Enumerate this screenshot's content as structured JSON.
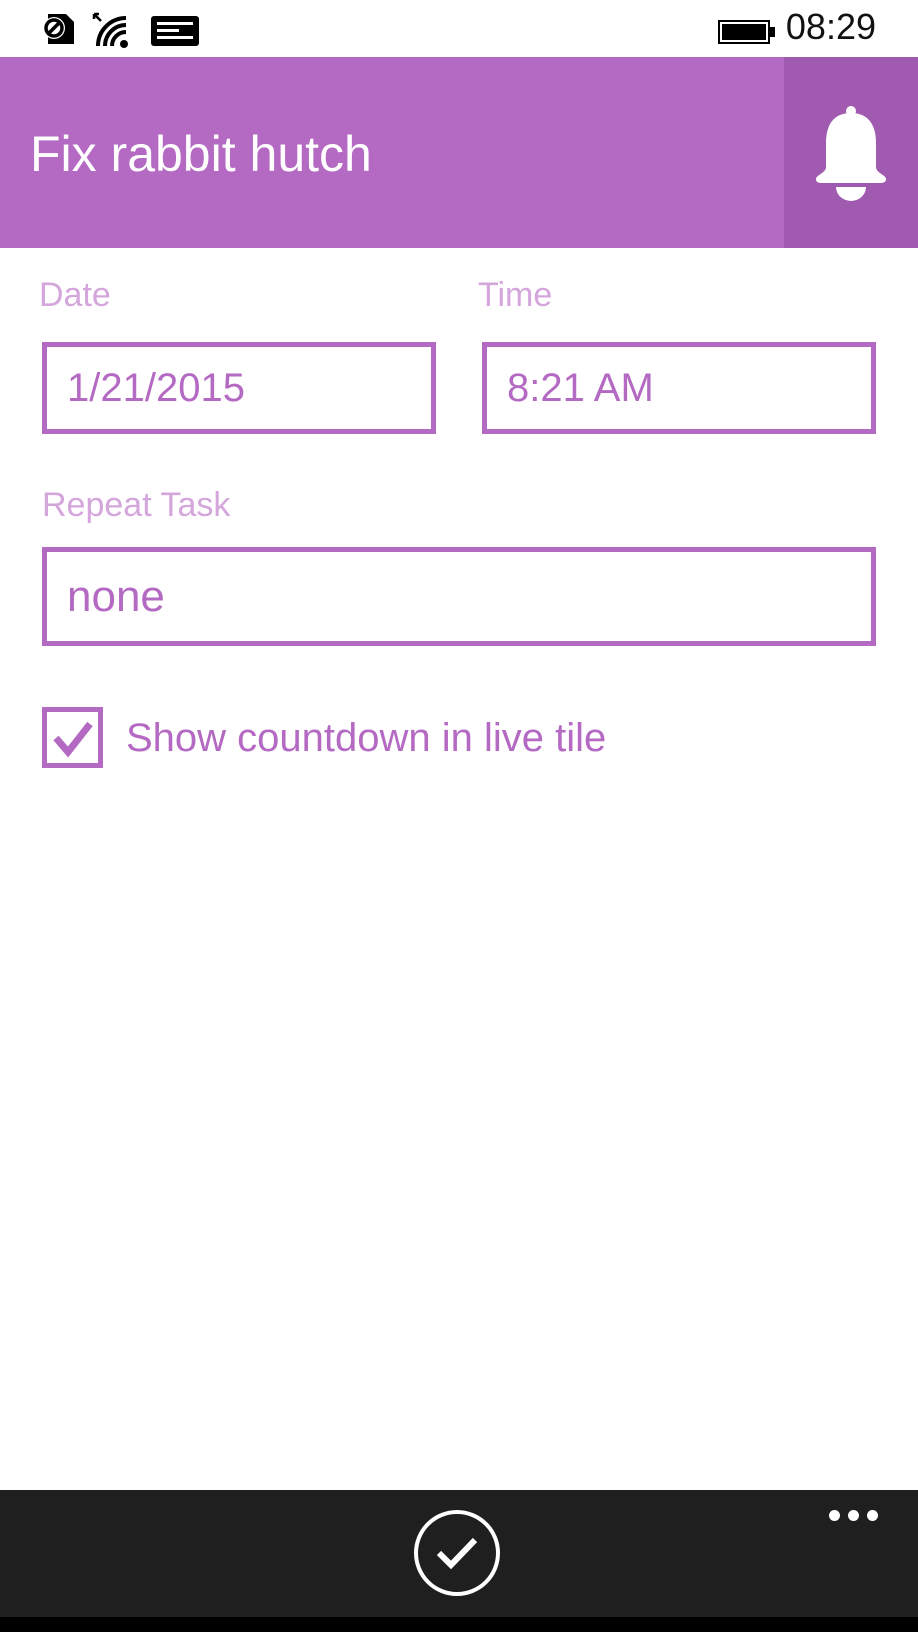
{
  "status_bar": {
    "icons": [
      "sim-card-icon",
      "wifi-icon",
      "message-icon",
      "battery-icon"
    ],
    "time": "08:29"
  },
  "header": {
    "title": "Fix rabbit hutch",
    "action_icon": "bell-icon"
  },
  "form": {
    "date_label": "Date",
    "date_value": "1/21/2015",
    "time_label": "Time",
    "time_value": "8:21 AM",
    "repeat_label": "Repeat Task",
    "repeat_value": "none",
    "countdown_label": "Show countdown in live tile",
    "countdown_checked": true
  },
  "app_bar": {
    "primary_icon": "checkmark-icon",
    "more_icon": "more-icon"
  },
  "colors": {
    "accent": "#b469c3",
    "accent_dark": "#a05aaf",
    "label": "#d4a6dc",
    "app_bar": "#1f1f1f"
  }
}
